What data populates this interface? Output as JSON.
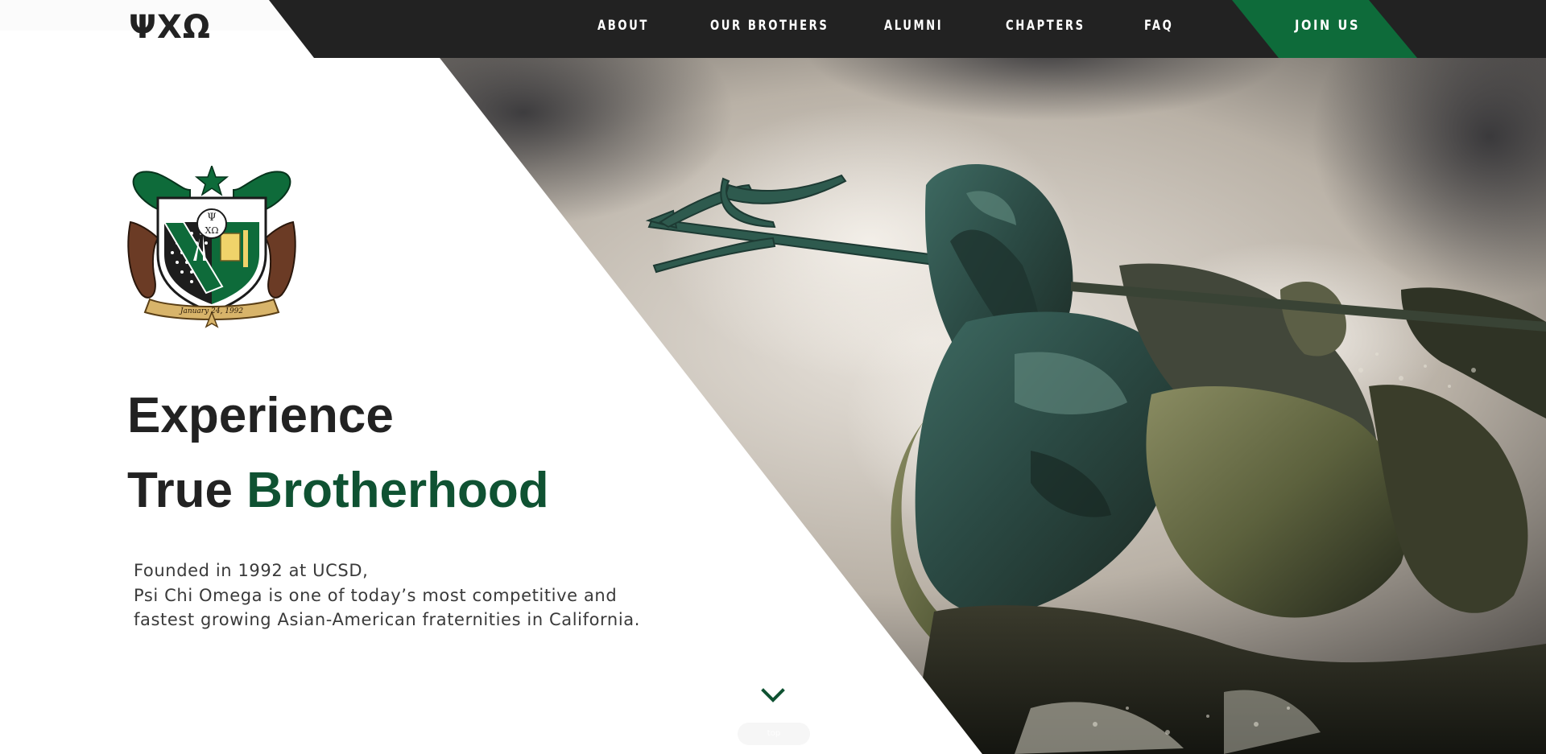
{
  "brand": {
    "logo_text": "ΨΧΩ"
  },
  "nav": {
    "items": [
      {
        "label": "ABOUT"
      },
      {
        "label": "OUR BROTHERS"
      },
      {
        "label": "ALUMNI"
      },
      {
        "label": "CHAPTERS"
      },
      {
        "label": "FAQ"
      }
    ],
    "cta_label": "JOIN US"
  },
  "hero": {
    "headline_line1": "Experience",
    "headline_line2_prefix": "True ",
    "headline_line2_accent": "Brotherhood",
    "intro_lines": [
      "Founded in 1992 at UCSD,",
      "Psi Chi Omega is one of today’s most competitive and",
      "fastest growing Asian-American fraternities in California."
    ],
    "crest_letters_top": "Ψ",
    "crest_letters_bottom": "ΧΩ",
    "crest_banner": "January 24, 1992",
    "scroll_pill_text": "top"
  },
  "colors": {
    "nav_background": "#222222",
    "brand_green": "#0e6b3a",
    "accent_text_green": "#0f5232",
    "headline_text": "#222222"
  },
  "icons": {
    "scroll": "chevron-down-icon"
  }
}
